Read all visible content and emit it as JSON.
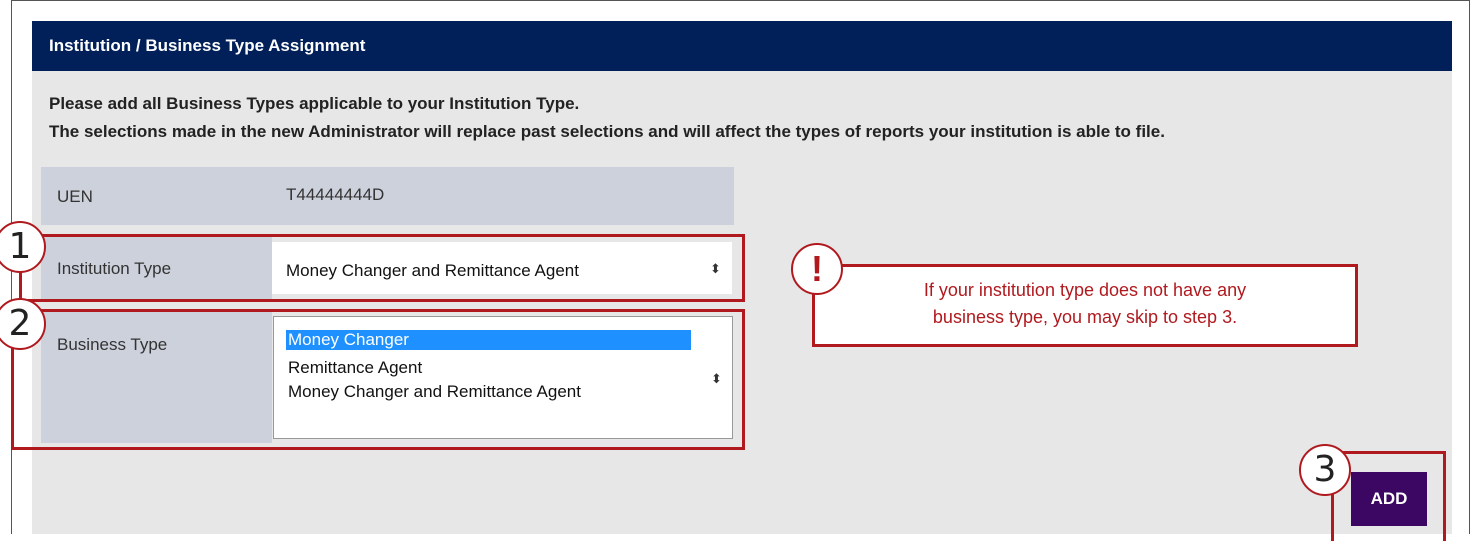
{
  "header": {
    "title": "Institution / Business Type Assignment"
  },
  "instructions": {
    "line1": "Please add all Business Types applicable to your Institution Type.",
    "line2": "The selections made in the new Administrator will replace past selections and will affect the types of reports your institution is able to file."
  },
  "form": {
    "uen": {
      "label": "UEN",
      "value": "T44444444D"
    },
    "institution_type": {
      "label": "Institution Type",
      "selected": "Money Changer and Remittance Agent",
      "arrow": "⬍"
    },
    "business_type": {
      "label": "Business Type",
      "options": [
        "Money Changer",
        "Remittance Agent",
        "Money Changer and Remittance Agent"
      ],
      "selected_index": 0,
      "arrow": "⬍"
    }
  },
  "annotations": {
    "step1": "1",
    "step2": "2",
    "step3": "3",
    "alert_symbol": "!",
    "callout_line1": "If your institution type does not have any",
    "callout_line2": "business type, you may skip to step 3.",
    "accent_color": "#b01a1f"
  },
  "actions": {
    "add_label": "ADD"
  },
  "colors": {
    "header_bg": "#01205a",
    "panel_bg": "#e7e7e7",
    "label_bg": "#cdd1dc",
    "button_bg": "#3b0763",
    "selection": "#1e90ff"
  }
}
